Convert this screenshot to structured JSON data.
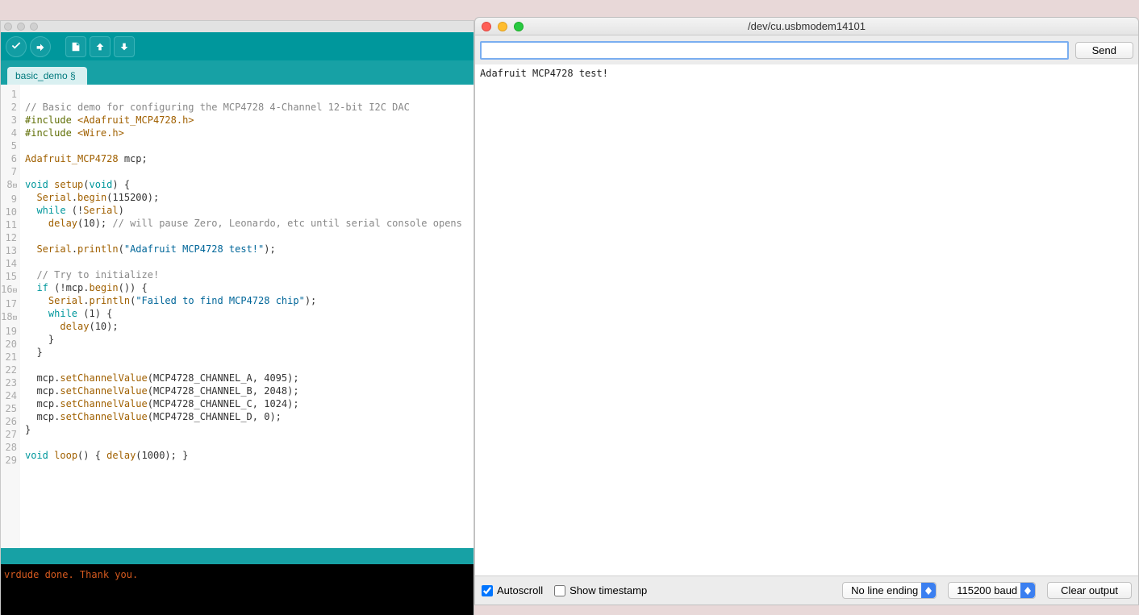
{
  "ide": {
    "tab_name": "basic_demo §",
    "code_lines": [
      {
        "n": "1",
        "t": ""
      },
      {
        "n": "2",
        "t": "// Basic demo for configuring the MCP4728 4-Channel 12-bit I2C DAC",
        "cls": "c-comment"
      },
      {
        "n": "3",
        "html": "<span class='c-prep'>#include</span> <span class='c-hl'>&lt;Adafruit_MCP4728.h&gt;</span>"
      },
      {
        "n": "4",
        "html": "<span class='c-prep'>#include</span> <span class='c-hl'>&lt;Wire.h&gt;</span>"
      },
      {
        "n": "5",
        "t": ""
      },
      {
        "n": "6",
        "html": "<span class='c-hl'>Adafruit_MCP4728</span> mcp;"
      },
      {
        "n": "7",
        "t": ""
      },
      {
        "n": "8",
        "fold": "⊟",
        "html": "<span class='c-kw'>void</span> <span class='c-hl'>setup</span>(<span class='c-kw'>void</span>) {"
      },
      {
        "n": "9",
        "html": "  <span class='c-hl'>Serial</span>.<span class='c-hl'>begin</span>(115200);"
      },
      {
        "n": "10",
        "html": "  <span class='c-kw'>while</span> (!<span class='c-hl'>Serial</span>)"
      },
      {
        "n": "11",
        "html": "    <span class='c-hl'>delay</span>(10); <span class='c-comment'>// will pause Zero, Leonardo, etc until serial console opens</span>"
      },
      {
        "n": "12",
        "t": ""
      },
      {
        "n": "13",
        "html": "  <span class='c-hl'>Serial</span>.<span class='c-hl'>println</span>(<span class='c-blue'>\"Adafruit MCP4728 test!\"</span>);"
      },
      {
        "n": "14",
        "t": ""
      },
      {
        "n": "15",
        "html": "  <span class='c-comment'>// Try to initialize!</span>"
      },
      {
        "n": "16",
        "fold": "⊟",
        "html": "  <span class='c-kw'>if</span> (!mcp.<span class='c-hl'>begin</span>()) {"
      },
      {
        "n": "17",
        "html": "    <span class='c-hl'>Serial</span>.<span class='c-hl'>println</span>(<span class='c-blue'>\"Failed to find MCP4728 chip\"</span>);"
      },
      {
        "n": "18",
        "fold": "⊟",
        "html": "    <span class='c-kw'>while</span> (1) {"
      },
      {
        "n": "19",
        "html": "      <span class='c-hl'>delay</span>(10);"
      },
      {
        "n": "20",
        "t": "    }"
      },
      {
        "n": "21",
        "t": "  }"
      },
      {
        "n": "22",
        "t": ""
      },
      {
        "n": "23",
        "html": "  mcp.<span class='c-hl'>setChannelValue</span>(MCP4728_CHANNEL_A, 4095);"
      },
      {
        "n": "24",
        "html": "  mcp.<span class='c-hl'>setChannelValue</span>(MCP4728_CHANNEL_B, 2048);"
      },
      {
        "n": "25",
        "html": "  mcp.<span class='c-hl'>setChannelValue</span>(MCP4728_CHANNEL_C, 1024);"
      },
      {
        "n": "26",
        "html": "  mcp.<span class='c-hl'>setChannelValue</span>(MCP4728_CHANNEL_D, 0);"
      },
      {
        "n": "27",
        "t": "}"
      },
      {
        "n": "28",
        "t": ""
      },
      {
        "n": "29",
        "html": "<span class='c-kw'>void</span> <span class='c-hl'>loop</span>() { <span class='c-hl'>delay</span>(1000); }"
      }
    ],
    "console_text": "vrdude done.  Thank you."
  },
  "monitor": {
    "title": "/dev/cu.usbmodem14101",
    "send_label": "Send",
    "output_lines": [
      "Adafruit MCP4728 test!"
    ],
    "autoscroll_label": "Autoscroll",
    "autoscroll_checked": true,
    "timestamp_label": "Show timestamp",
    "timestamp_checked": false,
    "line_ending_selected": "No line ending",
    "baud_selected": "115200 baud",
    "clear_label": "Clear output"
  }
}
